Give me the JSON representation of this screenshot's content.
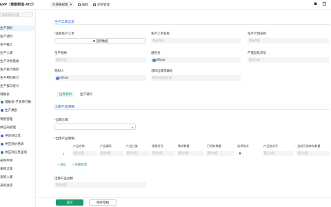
{
  "header": {
    "app_title": "ERP（离散制造-ATO）",
    "view_select": "仅填报视图",
    "actions": [
      "编辑",
      "权限管理"
    ]
  },
  "sidebar": {
    "search_placeholder": "搜索表单/页面",
    "items": [
      {
        "label": "生产领料",
        "active": true
      },
      {
        "label": "生产退料"
      },
      {
        "label": "生产报工"
      },
      {
        "label": "生产入库"
      },
      {
        "label": "生产计划看板"
      },
      {
        "label": "生产执行跟踪"
      },
      {
        "label": "生产用料统计"
      },
      {
        "label": "生产报工统计"
      },
      {
        "label": "辅助表"
      },
      {
        "label": "辅助表-子表单行数",
        "sub": true,
        "dot": true
      },
      {
        "label": "生产类别",
        "sub": true,
        "dot": true
      },
      {
        "label": "销售管理"
      },
      {
        "label": "供应商管理"
      },
      {
        "label": "供应商信息",
        "sub": true,
        "dot": true
      },
      {
        "label": "供应商价格表",
        "sub": true,
        "dot": true
      },
      {
        "label": "供应商信息查询",
        "sub": true,
        "dot": true
      },
      {
        "label": "采购申请"
      },
      {
        "label": "采购订单"
      },
      {
        "label": "采购入库"
      },
      {
        "label": "采购退货"
      }
    ]
  },
  "section1": {
    "title": "生产工单信息",
    "work_order_label": "*选择生产工单",
    "work_order_button": "选择数据",
    "work_order_name_label": "生产工单名称",
    "work_order_name_placeholder": "暂无内容",
    "plan_name_label": "生产计划名称",
    "plan_name_placeholder": "暂无内容",
    "product_spec_label": "生产规格",
    "product_spec_placeholder": "暂无内容",
    "group_leader_label": "组别长",
    "group_leader_value": "Official",
    "batch_label": "产成品批次号",
    "batch_placeholder": "暂无内容",
    "picker_label": "领料人",
    "picker_value": "Official",
    "code_label": "领料出库单编号",
    "code_placeholder": "提交后自动生成"
  },
  "tabs": [
    "出库领料",
    "生产退料"
  ],
  "section2": {
    "title": "出库产品明细",
    "warehouse_label": "*出库仓库",
    "details_label": "*出库产品明细",
    "columns": [
      "产品名称",
      "产品编码",
      "产品分类",
      "规格型号",
      "需求数量",
      "已领料数量",
      "选择批次",
      "产品批次号",
      "当前可用库存数量"
    ],
    "row_number": "1",
    "row_placeholder": "暂无内容",
    "add_label": "+ 添加",
    "bulk_add_label": "+ 快捷新增",
    "total_label": "出库产品总数",
    "total_placeholder": "暂无内容"
  },
  "footer": {
    "submit": "提交",
    "save_draft": "保存草稿"
  },
  "colors": {
    "accent": "#1a9e69",
    "section_title": "#1e63d8"
  }
}
